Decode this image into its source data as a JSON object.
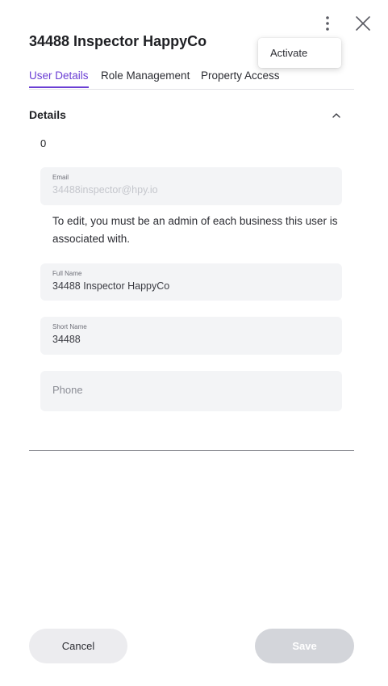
{
  "header": {
    "title": "34488 Inspector HappyCo",
    "more_icon": "kebab-vertical-icon",
    "close_icon": "close-x-icon"
  },
  "menu": {
    "items": [
      {
        "label": "Activate"
      }
    ]
  },
  "tabs": [
    {
      "label": "User Details",
      "active": true
    },
    {
      "label": "Role Management",
      "active": false
    },
    {
      "label": "Property Access",
      "active": false
    }
  ],
  "details": {
    "section_title": "Details",
    "collapse_icon": "chevron-up-icon",
    "count": "0",
    "email": {
      "label": "Email",
      "value": "34488inspector@hpy.io",
      "disabled": true
    },
    "notice": "To edit, you must be an admin of each business this user is associated with.",
    "full_name": {
      "label": "Full Name",
      "value": "34488 Inspector HappyCo"
    },
    "short_name": {
      "label": "Short Name",
      "value": "34488"
    },
    "phone": {
      "placeholder": "Phone",
      "value": ""
    }
  },
  "footer": {
    "cancel_label": "Cancel",
    "save_label": "Save"
  },
  "colors": {
    "accent": "#6b3fd4",
    "field_bg": "#f3f4f6",
    "save_disabled_bg": "#d3d5da",
    "cancel_bg": "#ececef"
  }
}
